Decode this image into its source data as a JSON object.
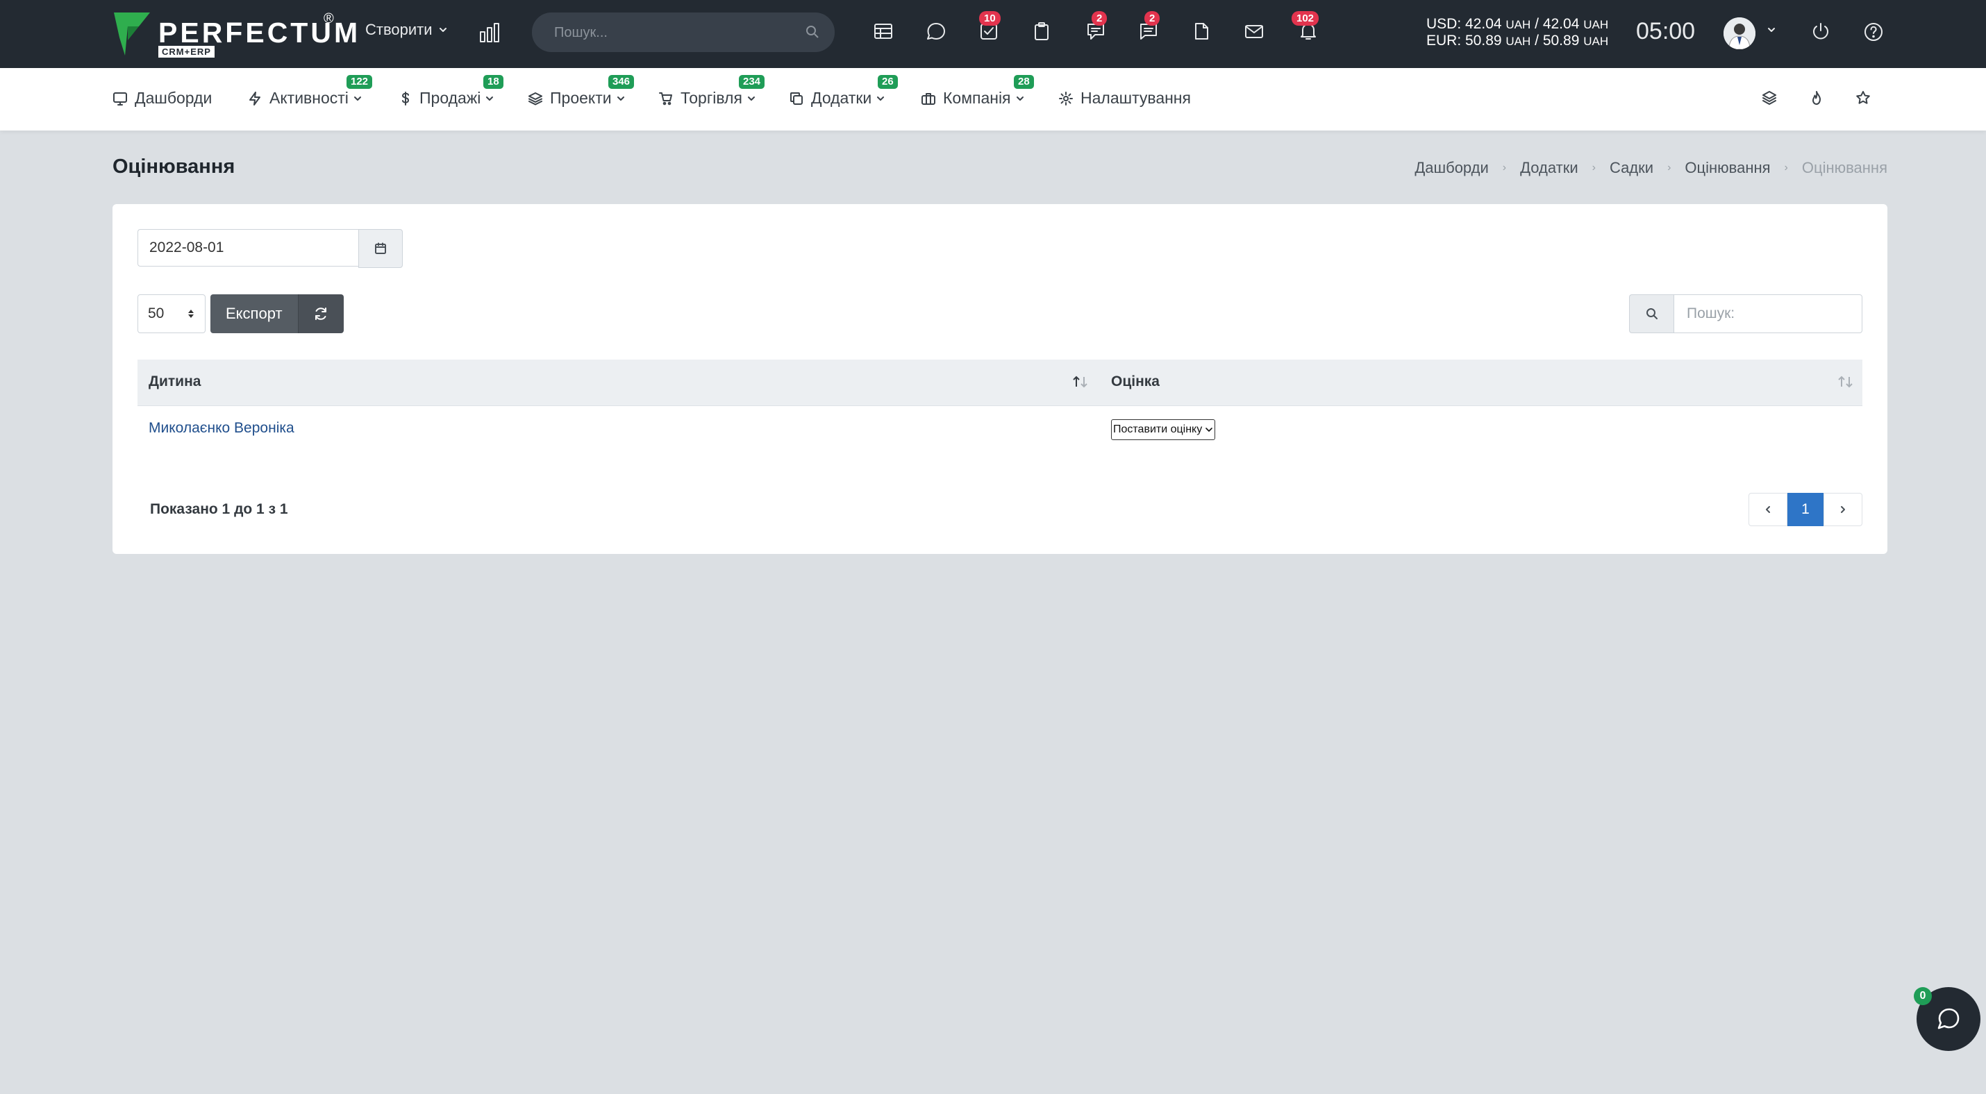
{
  "brand": {
    "name": "PERFECTUM",
    "reg": "®",
    "sub": "CRM+ERP"
  },
  "topbar": {
    "create_label": "Створити",
    "search_placeholder": "Пошук...",
    "badges": {
      "tasks": "10",
      "comments": "2",
      "chat": "2",
      "notifications": "102"
    },
    "rates": {
      "usd": "USD: 42.04",
      "eur": "EUR: 50.89",
      "usd_a": "42.04",
      "eur_a": "50.89",
      "currency": "UAH"
    },
    "clock": "05:00"
  },
  "nav": {
    "items": [
      {
        "label": "Дашборди",
        "badge": ""
      },
      {
        "label": "Активності",
        "badge": "122"
      },
      {
        "label": "Продажі",
        "badge": "18"
      },
      {
        "label": "Проекти",
        "badge": "346"
      },
      {
        "label": "Торгівля",
        "badge": "234"
      },
      {
        "label": "Додатки",
        "badge": "26"
      },
      {
        "label": "Компанія",
        "badge": "28"
      },
      {
        "label": "Налаштування",
        "badge": ""
      }
    ]
  },
  "page": {
    "title": "Оцінювання",
    "breadcrumb": [
      "Дашборди",
      "Додатки",
      "Садки",
      "Оцінювання",
      "Оцінювання"
    ]
  },
  "filters": {
    "date": "2022-08-01",
    "per_page": "50",
    "export_label": "Експорт",
    "search_placeholder": "Пошук:"
  },
  "table": {
    "columns": [
      "Дитина",
      "Оцінка"
    ],
    "rows": [
      {
        "child": "Миколаєнко Вероніка",
        "grade": "Поставити оцінку"
      }
    ]
  },
  "footer": {
    "info": "Показано 1 до 1 з 1",
    "current_page": "1"
  },
  "chat": {
    "badge": "0"
  }
}
